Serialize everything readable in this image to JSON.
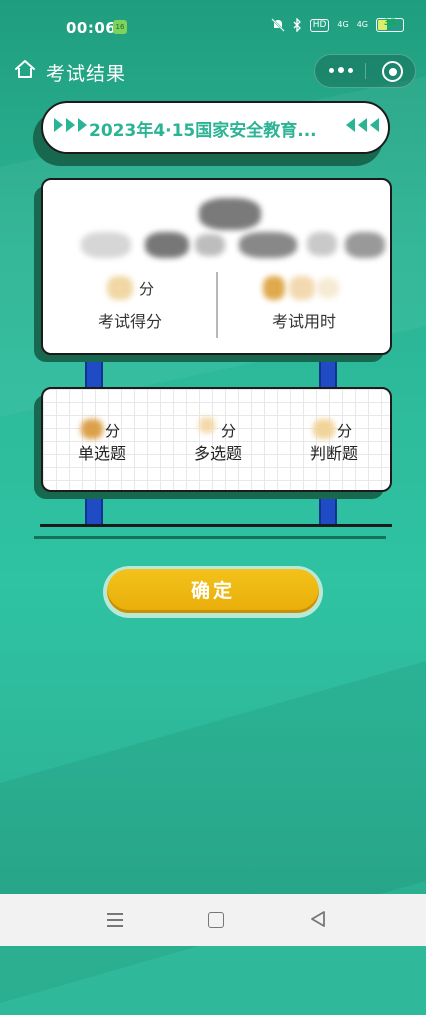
{
  "status_bar": {
    "time": "00:06",
    "wechat_badge": "16",
    "hd_label": "HD",
    "signal_1": "4G",
    "signal_2": "4G",
    "battery": "35",
    "battery_level": 0.35,
    "icons": [
      "mute-bell-icon",
      "bluetooth-icon",
      "hd-icon",
      "signal-icon",
      "signal-icon",
      "battery-icon"
    ]
  },
  "nav": {
    "title": "考试结果",
    "home_icon": "home-icon",
    "more_icon": "more-dots-icon",
    "close_icon": "close-circle-icon"
  },
  "exam": {
    "title": "2023年4·15国家安全教育..."
  },
  "score_card": {
    "score_unit": "分",
    "score_label": "考试得分",
    "time_label": "考试用时"
  },
  "question_types": [
    {
      "unit": "分",
      "label": "单选题"
    },
    {
      "unit": "分",
      "label": "多选题"
    },
    {
      "unit": "分",
      "label": "判断题"
    }
  ],
  "confirm_button": {
    "label": "确定"
  },
  "colors": {
    "accent": "#2bb494",
    "button": "#f0b712",
    "post": "#1f4bc4"
  },
  "system_nav": {
    "icons": [
      "menu-icon",
      "home-square-icon",
      "back-triangle-icon"
    ]
  }
}
